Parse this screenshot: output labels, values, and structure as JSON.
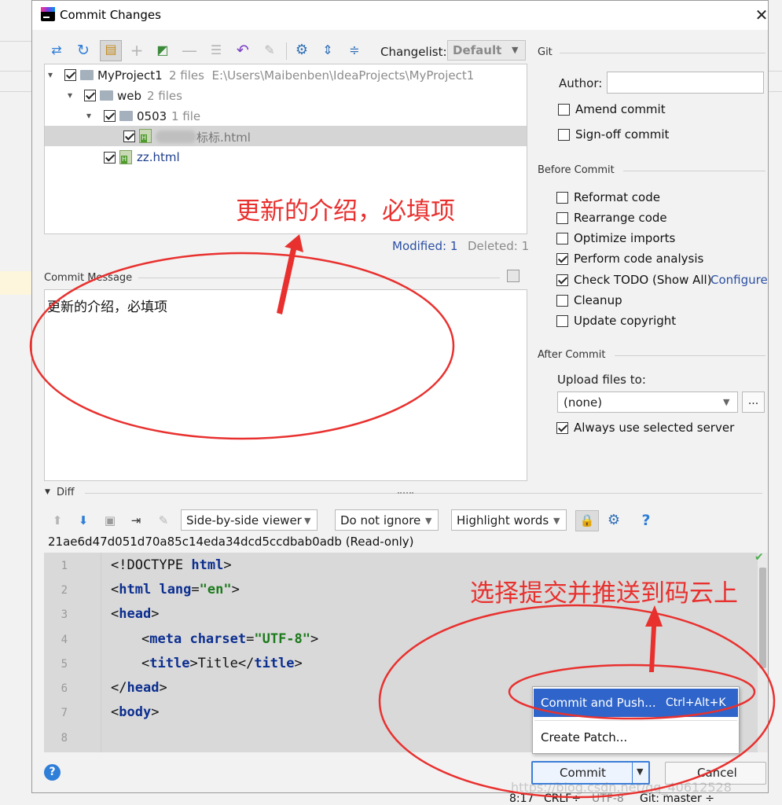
{
  "dialog": {
    "title": "Commit Changes",
    "close_glyph": "✕"
  },
  "toolbar": {
    "changelist_label": "Changelist:",
    "changelist_value": "Default",
    "icons": [
      "compare-icon",
      "refresh-icon",
      "vcs-history-icon",
      "add-icon",
      "move-icon",
      "remove-icon",
      "group-icon",
      "rollback-icon",
      "show-diff-icon",
      "settings-icon",
      "expand-all-icon",
      "collapse-all-icon"
    ]
  },
  "tree": {
    "rows": [
      {
        "name": "MyProject1",
        "meta": "2 files  E:\\Users\\Maibenben\\IdeaProjects\\MyProject1"
      },
      {
        "name": "web",
        "meta": "2 files"
      },
      {
        "name": "0503",
        "meta": "1 file"
      },
      {
        "name": "标标.html",
        "meta": ""
      },
      {
        "name": "zz.html",
        "meta": ""
      }
    ],
    "modified": "Modified: 1",
    "deleted": "Deleted: 1"
  },
  "commit_message": {
    "label": "Commit Message",
    "text": "更新的介绍，必填项"
  },
  "git_panel": {
    "section_git": "Git",
    "author_label": "Author:",
    "author_value": "",
    "amend": "Amend commit",
    "signoff": "Sign-off commit",
    "section_before": "Before Commit",
    "reformat": "Reformat code",
    "rearrange": "Rearrange code",
    "optimize": "Optimize imports",
    "analysis": "Perform code analysis",
    "todo": "Check TODO (Show All)",
    "configure": "Configure",
    "cleanup": "Cleanup",
    "copyright": "Update copyright",
    "section_after": "After Commit",
    "upload_label": "Upload files to:",
    "upload_value": "(none)",
    "upload_browse": "...",
    "always_use": "Always use selected server"
  },
  "diff": {
    "label": "Diff",
    "viewer": "Side-by-side viewer",
    "ignore": "Do not ignore",
    "highlight": "Highlight words",
    "help": "?",
    "hash": "21ae6d47d051d70a85c14eda34dcd5ccdbab0adb (Read-only)",
    "line_numbers": [
      "1",
      "2",
      "3",
      "4",
      "5",
      "6",
      "7",
      "8"
    ]
  },
  "popup": {
    "commit_push": "Commit and Push...",
    "commit_push_shortcut": "Ctrl+Alt+K",
    "create_patch": "Create Patch..."
  },
  "buttons": {
    "help": "?",
    "commit": "Commit",
    "cancel": "Cancel"
  },
  "statusbar": {
    "time": "8:17",
    "line_sep": "CRLF÷",
    "encoding": "UTF-8",
    "branch": "Git: master ÷"
  },
  "watermark": "https://blog.csdn.net/qq_40612528",
  "annotations": {
    "top": "更新的介绍，必填项",
    "bottom": "选择提交并推送到码云上",
    "color": "#e8312f"
  },
  "colors": {
    "selection": "#2f65ca",
    "link": "#2b4fa3",
    "code_bg": "#d9d9d9"
  }
}
